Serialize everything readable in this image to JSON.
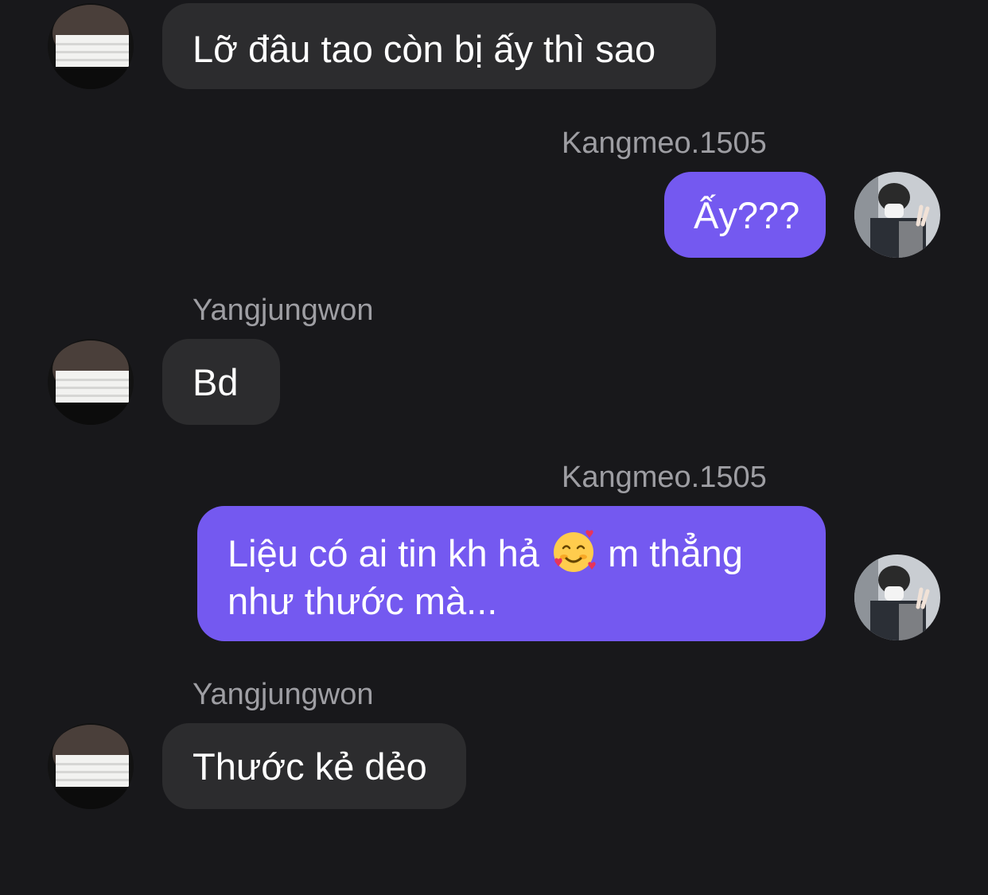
{
  "messages": [
    {
      "direction": "incoming",
      "sender": "",
      "text": "Lỡ đâu tao còn bị ấy thì sao"
    },
    {
      "direction": "outgoing",
      "sender": "Kangmeo.1505",
      "text": "Ấy???"
    },
    {
      "direction": "incoming",
      "sender": "Yangjungwon",
      "text": "Bd"
    },
    {
      "direction": "outgoing",
      "sender": "Kangmeo.1505",
      "text_before_emoji": "Liệu có ai tin kh hả",
      "emoji": "smiling-face-with-hearts",
      "text_after_emoji": "m thẳng",
      "text_line2": "như thước mà..."
    },
    {
      "direction": "incoming",
      "sender": "Yangjungwon",
      "text": "Thước kẻ dẻo"
    }
  ],
  "colors": {
    "background": "#18181b",
    "incoming_bubble": "#2c2c2e",
    "outgoing_bubble": "#7459f0",
    "sender_text": "#9e9ea3",
    "message_text": "#ffffff"
  }
}
